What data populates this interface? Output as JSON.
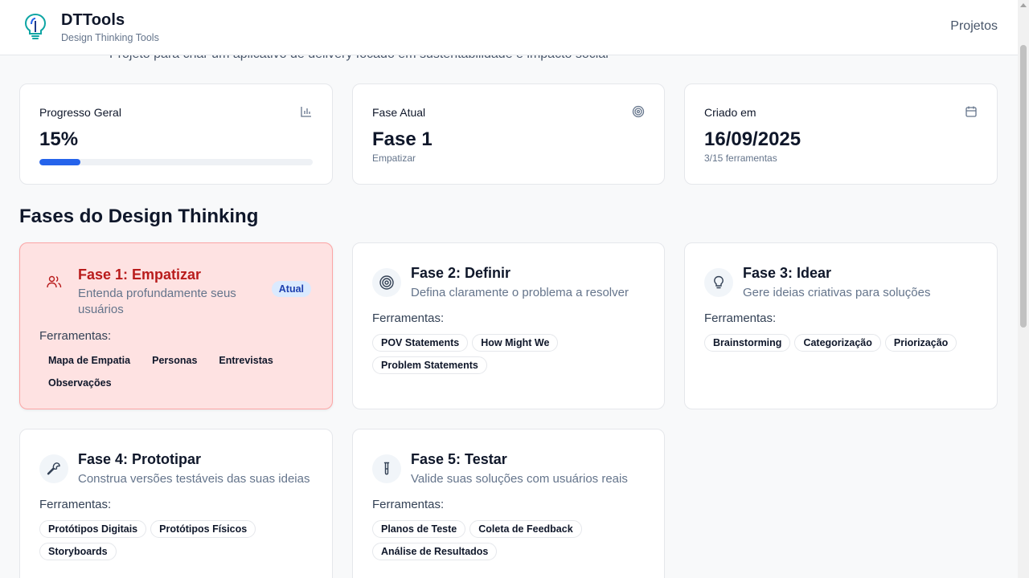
{
  "header": {
    "brand_title": "DTTools",
    "brand_subtitle": "Design Thinking Tools",
    "nav_projects": "Projetos"
  },
  "project": {
    "description": "Projeto para criar um aplicativo de delivery focado em sustentabilidade e impacto social"
  },
  "stats": {
    "progress": {
      "label": "Progresso Geral",
      "value": "15%",
      "fraction": 0.15,
      "icon": "bar-chart-icon"
    },
    "phase": {
      "label": "Fase Atual",
      "value": "Fase 1",
      "sub": "Empatizar",
      "icon": "target-icon"
    },
    "created": {
      "label": "Criado em",
      "value": "16/09/2025",
      "sub": "3/15 ferramentas",
      "icon": "calendar-icon"
    }
  },
  "section_title": "Fases do Design Thinking",
  "tools_label": "Ferramentas:",
  "phases": [
    {
      "title": "Fase 1: Empatizar",
      "desc": "Entenda profundamente seus usuários",
      "badge": "Atual",
      "icon": "users-icon",
      "color": "#b91c1c",
      "tools": [
        "Mapa de Empatia",
        "Personas",
        "Entrevistas",
        "Observações"
      ]
    },
    {
      "title": "Fase 2: Definir",
      "desc": "Defina claramente o problema a resolver",
      "icon": "target-icon",
      "tools": [
        "POV Statements",
        "How Might We",
        "Problem Statements"
      ]
    },
    {
      "title": "Fase 3: Idear",
      "desc": "Gere ideias criativas para soluções",
      "icon": "lightbulb-icon",
      "tools": [
        "Brainstorming",
        "Categorização",
        "Priorização"
      ]
    },
    {
      "title": "Fase 4: Prototipar",
      "desc": "Construa versões testáveis das suas ideias",
      "icon": "wrench-icon",
      "tools": [
        "Protótipos Digitais",
        "Protótipos Físicos",
        "Storyboards"
      ]
    },
    {
      "title": "Fase 5: Testar",
      "desc": "Valide suas soluções com usuários reais",
      "icon": "test-tube-icon",
      "tools": [
        "Planos de Teste",
        "Coleta de Feedback",
        "Análise de Resultados"
      ]
    }
  ],
  "colors": {
    "accent": "#2563eb",
    "current_phase_bg": "#fee2e2",
    "current_phase_text": "#b91c1c",
    "badge_bg": "#dbeafe"
  }
}
